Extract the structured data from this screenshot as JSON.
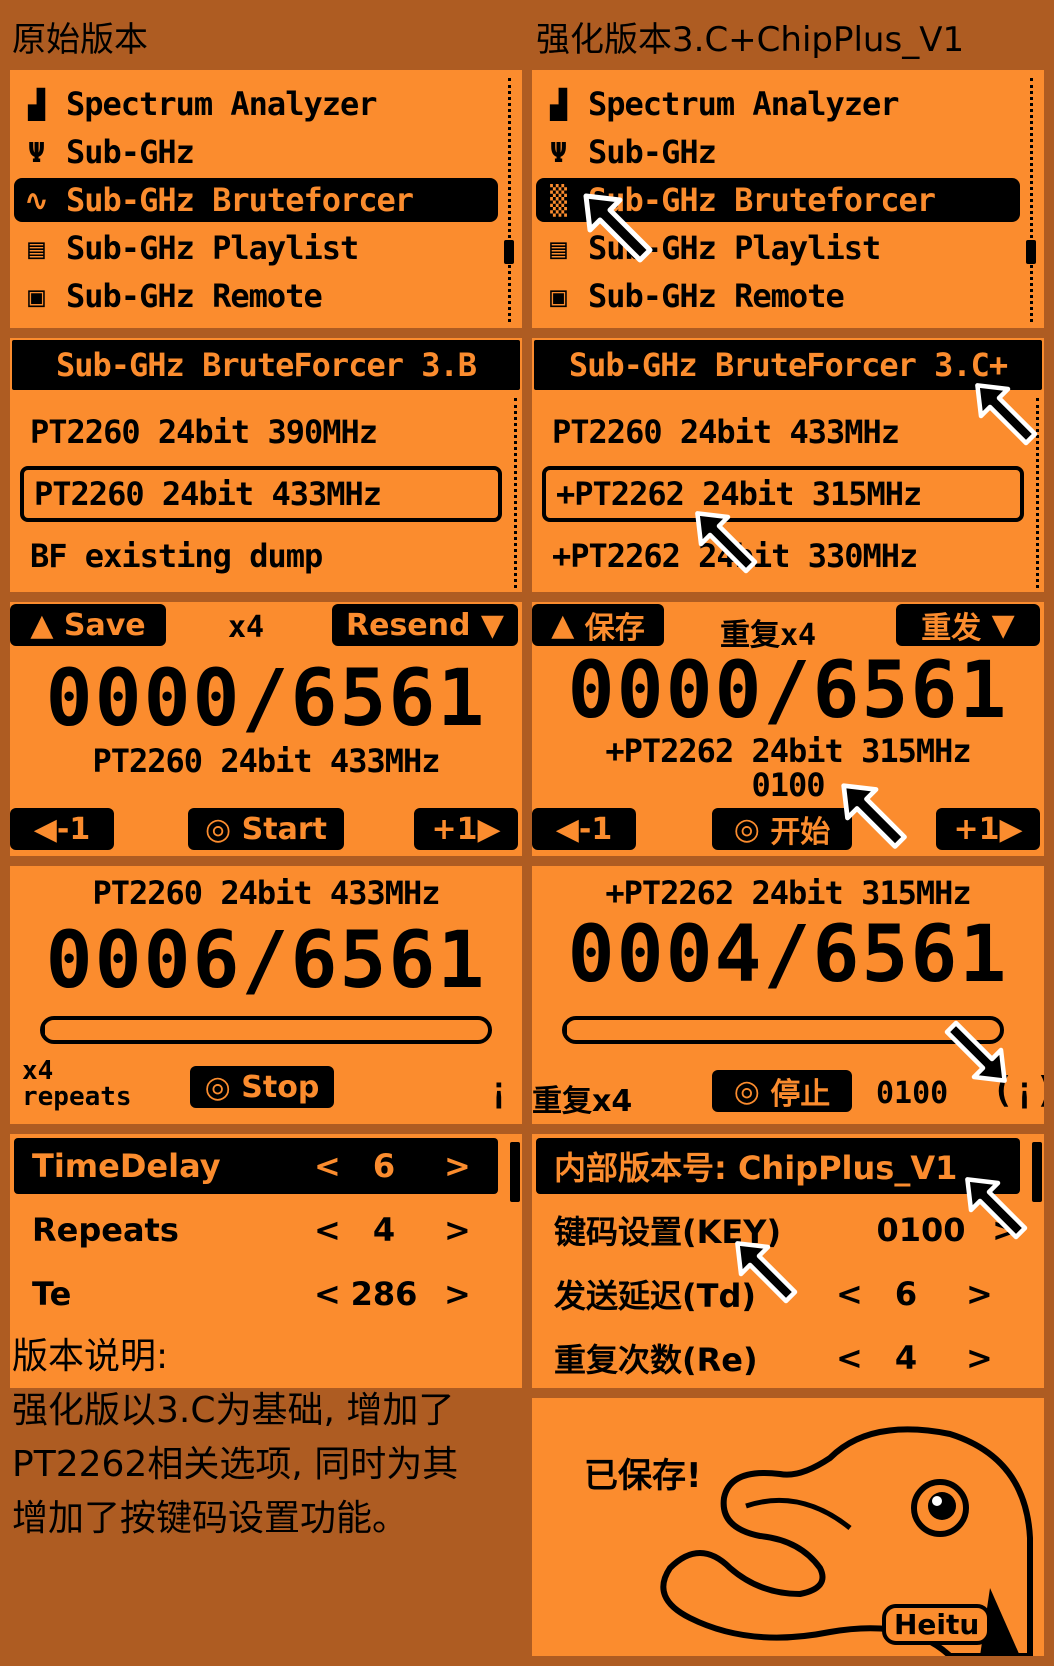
{
  "headers": {
    "left": "原始版本",
    "right": "强化版本3.C+ChipPlus_V1"
  },
  "menu": {
    "items": [
      "Spectrum Analyzer",
      "Sub-GHz",
      "Sub-GHz Bruteforcer",
      "Sub-GHz Playlist",
      "Sub-GHz Remote"
    ],
    "selected": "Sub-GHz Bruteforcer"
  },
  "protocol_left": {
    "title": "Sub-GHz BruteForcer 3.B",
    "options": [
      "PT2260 24bit 390MHz",
      "PT2260 24bit 433MHz",
      "BF existing dump"
    ],
    "selected": "PT2260 24bit 433MHz"
  },
  "protocol_right": {
    "title": "Sub-GHz BruteForcer 3.C+",
    "options": [
      "PT2260 24bit 433MHz",
      "+PT2262 24bit 315MHz",
      "+PT2262 24bit 330MHz"
    ],
    "selected": "+PT2262 24bit 315MHz"
  },
  "ready_left": {
    "save": "Save",
    "repeat": "x4",
    "resend": "Resend",
    "counter": "0000/6561",
    "protocol": "PT2260 24bit 433MHz",
    "minus": "-1",
    "start": "Start",
    "plus": "+1"
  },
  "ready_right": {
    "save": "保存",
    "repeat": "重复x4",
    "resend": "重发",
    "counter": "0000/6561",
    "protocol": "+PT2262 24bit 315MHz",
    "key": "0100",
    "minus": "-1",
    "start": "开始",
    "plus": "+1"
  },
  "running_left": {
    "protocol": "PT2260 24bit 433MHz",
    "counter": "0006/6561",
    "progress": 0.0009,
    "repeats_count": "x4",
    "repeats_label": "repeats",
    "stop": "Stop"
  },
  "running_right": {
    "protocol": "+PT2262 24bit 315MHz",
    "counter": "0004/6561",
    "progress": 0.0006,
    "repeats": "重复x4",
    "stop": "停止",
    "key": "0100"
  },
  "settings_left": {
    "rows": [
      {
        "label": "TimeDelay",
        "value": "6"
      },
      {
        "label": "Repeats",
        "value": "4"
      },
      {
        "label": "Te",
        "value": "286"
      }
    ]
  },
  "settings_right": {
    "header": "内部版本号: ChipPlus_V1",
    "rows": [
      {
        "label": "键码设置(KEY)",
        "value": "0100"
      },
      {
        "label": "发送延迟(Td)",
        "value": "6"
      },
      {
        "label": "重复次数(Re)",
        "value": "4"
      }
    ]
  },
  "saved": {
    "text": "已保存!",
    "signature": "Heitu"
  },
  "notes": {
    "title": "版本说明:",
    "lines": [
      "强化版以3.C为基础, 增加了",
      "PT2262相关选项, 同时为其",
      "增加了按键码设置功能。"
    ]
  },
  "arrows": {
    "lt": "<",
    "gt": ">"
  },
  "colors": {
    "background": "#AE5C22",
    "lcd": "#FB8C2E",
    "ink": "#000000"
  }
}
